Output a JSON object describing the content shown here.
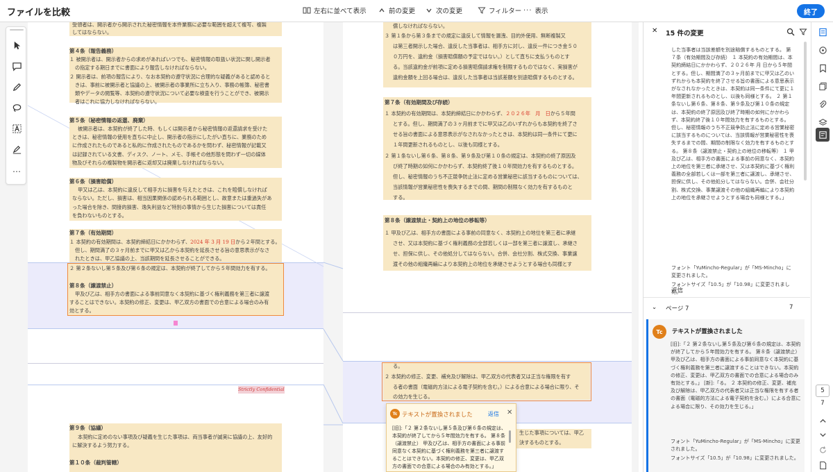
{
  "window": {
    "title": "ファイルを比較"
  },
  "toolbar": {
    "side_by_side": "左右に並べて表示",
    "prev_change": "前の変更",
    "next_change": "次の変更",
    "filter": "フィルター",
    "view": "表示",
    "done": "終了"
  },
  "left_doc": {
    "lines": [
      "受領者は、開示者から開示された秘密情報を本件業務に必要な範囲を超えて複写、複製",
      "してはならない。",
      "第４条（報告義務）",
      "１ 被開示者は、開示者からの求めがあればいつでも、秘密情報の取扱い状況に関し開示者",
      "の指定する期日までに書面により報告しなければならない。",
      "２ 開示者は、前項の報告により、なお本契約の遵守状況に合理的な疑義があると認めると",
      "きは、事前に被開示者と協議の上、被開示者の事業所に立ち入り、事務の帳簿、秘密書",
      "類やデータの閲覧等、本契約の遵守状況について必要な検査を行うことができ、被開示",
      "者はこれに協力しなければならない。",
      "第５条（秘密情報の返還、廃棄）",
      "被開示者は、本契約が終了した時、もしくは開示者から秘密情報の返還請求を受けた",
      "ときは、秘密情報の使用を直ちに中止し、開示者の指示にしたがい直ちに、業務のため",
      "に作成されたものであると私的に作成されたものであるかを問わず、秘密情報が記載又",
      "は記録されている文書、ディスク、ノート、メモ、手帳その他形態を問わず一切の媒体",
      "物及びそれらの複製物を開示者に返却又は廃棄しなければならない。",
      "第６条（損害賠償）",
      "甲又は乙は、本契約に違反して相手方に損害を与えたときは、これを賠償しなければ",
      "ならない。ただし、損害は、相当因果関係の認められる範囲とし、故意または重過失があ",
      "った場合を除き、間接的損害、逸失利益など特別の事情から生じた損害については責任",
      "を負わないものとする。",
      "第７条（有効期間）",
      "１ 本契約の有効期間は、本契約締結日にかかわらず、",
      "2024 年 3 月 19 日",
      "から２年間とする。",
      "但し、期間満了の３ヶ月前までに甲又は乙から本契約を延長させる旨の意思表示がなさ",
      "れたときは、甲乙協議の上、当該期間を延長させることができる。",
      "２ 第２条ないし第５条及び第６条の規定は、本契約が終了してから５年間効力を有する。",
      "第８条（譲渡禁止）",
      "甲及び乙は、相手方の書面による事前同意なく本契約に基づく権利義務を第三者に譲渡",
      "することはできない。本契約の修正、変更は、甲乙双方の書面での合意による場合のみ有",
      "効とする。",
      "Strictly Confidential",
      "第９条（協議）",
      "本契約に定めのない事項及び疑義を生じた事項は、両当事者が誠実に協議の上、友好的",
      "に解決するよう努力する。",
      "第１０条（裁判管轄）"
    ]
  },
  "right_doc": {
    "lines": [
      "償しなければならない。",
      "３ 第１条から第３条までの規定に違反して情報を漏洩、目的外使用、無断複製又",
      "は第三者開示した場合、違反した当事者は、相手方に対し、違反一件につき金５０",
      "０万円を、違約金（損害賠償額の予定ではない。）として直ちに支払うものとす",
      "る。当該違約金が前項に定める損害賠償請求権を制限するものではなく、実損害が",
      "違約金額を上回る場合は、違反した当事者は当該差額を別途賠償するものとする。",
      "第７条（有効期間及び存続）",
      "１ 本契約の有効期間は、本契約締結日にかかわらず、",
      "２０２６年　月　日",
      "から５年間",
      "とする。但し、期間満了の３ヶ月前までに甲又は乙のいずれからも本契約を終了さ",
      "せる旨の書面による意思表示がなされなかったときは、本契約は同一条件にて更に",
      "１年間更新されるものとし、以後も同様とする。",
      "２ 第１条ないし第６条、第８条、第９条及び第１０条の規定は、本契約の終了原因及",
      "び終了時期の如何にかかわらず、本契約終了後１０年間効力を有するものとする。",
      "但し、秘密情報のうち不正競争防止法に定める営業秘密に該当するものについては、",
      "当該情報が営業秘密性を喪失するまでの間、期間の制限なく効力を有するものと",
      "する。",
      "第８条（譲渡禁止・契約上の地位の移転等）",
      "１ 甲及び乙は、相手方の書面による事前の同意なく、本契約上の地位を第三者に承継",
      "させ、又は本契約に基づく権利義務の全部若しくは一部を第三者に譲渡し、承継さ",
      "せ、担保に供し、その他処分してはならない。合併、会社分割、株式交換、事業譲",
      "渡その他の組織再編により本契約上の地位を承継させようとする場合も同様とす",
      "る。",
      "２ 本契約の修正、変更、補充及び解除は、甲乙双方の代表者又は正当な権限を有す",
      "る者の書面（電磁的方法による電子契約を含む。）による合意による場合に限り、そ",
      "の効力を生じる。",
      "生じた事項については、甲乙",
      "決するものとする。"
    ]
  },
  "popup": {
    "title": "テキストが置換されました",
    "reply": "返信",
    "avatar": "Tc",
    "body": "[旧]:「２ 第２条ないし第５条及び第６条の規定は、本契約が終了してから５年間効力を有する。 第８条（譲渡禁止） 甲及び乙は、相手方の書面による事前同意なく本契約に基づく権利義務を第三者に譲渡することはできない。本契約の修正、変更は、甲乙双方の書面での合意による場合のみ有効とする。」"
  },
  "panel": {
    "title": "15 件の変更",
    "top_text": "した当事者は当該差額を別途賠償するものとする。 第７条（有効期間及び存続） １ 本契約の有効期間は、本契約締結日にかかわらず、２０２６年 月 日から５年間とする。但し、期間満了の３ヶ月前までに甲又は乙のいずれからも本契約を終了させる旨の書面による意思表示がなされなかったときは、本契約は同一条件にて更に１年間更新されるものとし、以後も同様とする。 ２ 第１条ないし第６条、第８条、第９条及び第１０条の規定は、本契約の終了原因及び終了時期の如何にかかわらず、本契約終了後１０年間効力を有するものとする。 但し、秘密情報のうち不正競争防止法に定める営業秘密に該当するものについては、当該情報が営業秘密性を喪失するまでの間、期間の制限なく効力を有するものとする。 第８条（譲渡禁止・契約上の地位の移転等） １ 甲及び乙は、相手方の書面による事前の同意なく、本契約上の地位を第三者に承継させ、又は本契約に基づく権利義務の全部若しくは一部を第三者に譲渡し、承継させ、担保に供し、その他処分してはならない。合併、会社分割、株式交換、事業譲渡その他の組織再編により本契約上の地位を承継させようとする場合も同様とする。」",
    "font_change": "フォント「YuMincho-Regular」が「MS-Mincho」に変更されました。",
    "size_change": "フォントサイズ「10.5」が「10.98」に変更されました。",
    "reply": "返信",
    "page_label": "ページ 7",
    "page_count": "7",
    "card": {
      "avatar": "Tc",
      "title": "テキストが置換されました",
      "body": "[旧]:「２ 第２条ないし第５条及び第６条の規定は、本契約が終了してから５年間効力を有する。 第８条（譲渡禁止） 甲及び乙は、相手方の書面による事前同意なく本契約に基づく権利義務を第三者に譲渡することはできない。本契約の修正、変更は、甲乙双方の書面での合意による場合のみ有効とする。」 [新]:「る。 ２ 本契約の修正、変更、補充及び解除は、甲乙双方の代表者又は正当な権限を有する者の書面（電磁的方法による電子契約を含む。）による合意による場合に限り、その効力を生じる。」",
      "font_change": "フォント「YuMincho-Regular」が「MS-Mincho」に変更されました。",
      "size_change": "フォントサイズ「10.5」が「10.98」に変更されました。"
    }
  },
  "rail": {
    "page_current": "5",
    "page_total": "7"
  },
  "colors": {
    "accent": "#1473e6",
    "change_orange": "#f08a3c",
    "highlight": "#f8e8c4",
    "band": "#ebebfb",
    "date_red": "#d93a2b"
  },
  "icons": [
    "select-icon",
    "comment-icon",
    "pen-icon",
    "lasso-icon",
    "text-select-icon",
    "sign-icon",
    "more-icon",
    "close-icon",
    "search-icon",
    "filter-icon",
    "chevron-down-icon",
    "chevron-up-icon",
    "chevron-left-icon"
  ]
}
